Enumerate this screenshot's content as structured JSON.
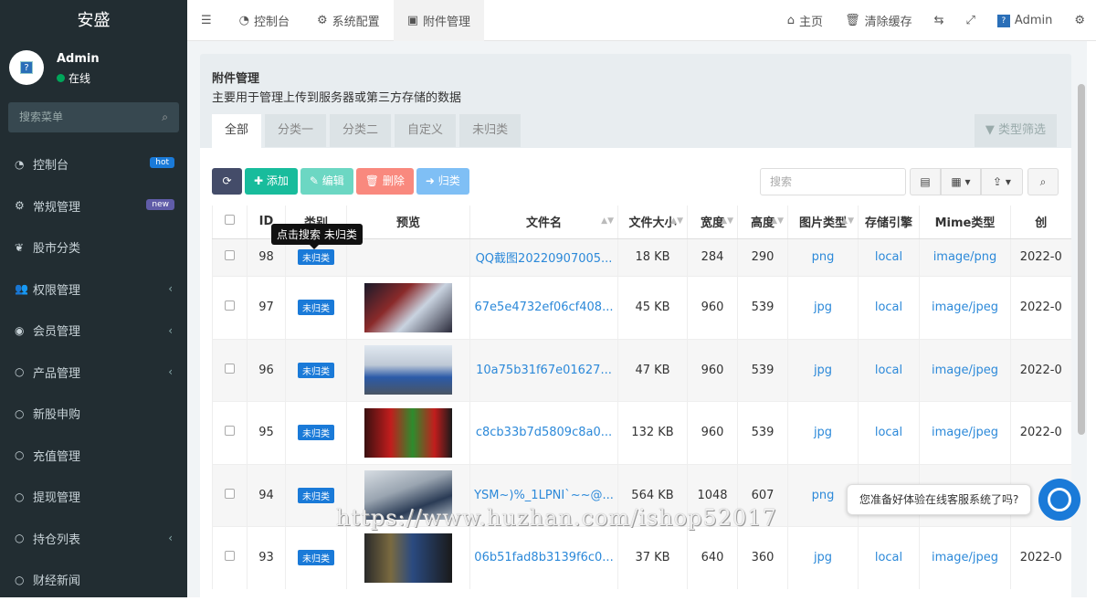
{
  "brand": "安盛",
  "user": {
    "name": "Admin",
    "status": "在线"
  },
  "sidebar": {
    "search_placeholder": "搜索菜单",
    "items": [
      {
        "label": "控制台",
        "badge": "hot",
        "icon": "dashboard-icon"
      },
      {
        "label": "常规管理",
        "badge": "new",
        "icon": "cogs-icon"
      },
      {
        "label": "股市分类",
        "icon": "leaf-icon"
      },
      {
        "label": "权限管理",
        "icon": "group-icon",
        "expandable": true
      },
      {
        "label": "会员管理",
        "icon": "user-circle-icon",
        "expandable": true
      },
      {
        "label": "产品管理",
        "icon": "circle-icon",
        "expandable": true
      },
      {
        "label": "新股申购",
        "icon": "circle-icon"
      },
      {
        "label": "充值管理",
        "icon": "circle-icon"
      },
      {
        "label": "提现管理",
        "icon": "circle-icon"
      },
      {
        "label": "持仓列表",
        "icon": "circle-icon",
        "expandable": true
      },
      {
        "label": "财经新闻",
        "icon": "circle-icon"
      }
    ]
  },
  "topnav": {
    "tabs": [
      {
        "label": "控制台",
        "icon": "dashboard-icon"
      },
      {
        "label": "系统配置",
        "icon": "gear-icon"
      },
      {
        "label": "附件管理",
        "icon": "file-image-icon",
        "active": true
      }
    ],
    "right": {
      "home": "主页",
      "clear_cache": "清除缓存",
      "user": "Admin"
    }
  },
  "panel": {
    "title": "附件管理",
    "description": "主要用于管理上传到服务器或第三方存储的数据",
    "tabs": [
      "全部",
      "分类一",
      "分类二",
      "自定义",
      "未归类"
    ],
    "filter_label": "类型筛选"
  },
  "toolbar": {
    "add": "添加",
    "edit": "编辑",
    "delete": "删除",
    "classify": "归类",
    "search_placeholder": "搜索"
  },
  "table": {
    "headers": [
      "ID",
      "类别",
      "预览",
      "文件名",
      "文件大小",
      "宽度",
      "高度",
      "图片类型",
      "存储引擎",
      "Mime类型",
      "创"
    ],
    "rows": [
      {
        "id": "98",
        "cat": "未归类",
        "file": "QQ截图20220907005...",
        "size": "18 KB",
        "w": "284",
        "h": "290",
        "type": "png",
        "engine": "local",
        "mime": "image/png",
        "date": "2022-0"
      },
      {
        "id": "97",
        "cat": "未归类",
        "file": "67e5e4732ef06cf408...",
        "size": "45 KB",
        "w": "960",
        "h": "539",
        "type": "jpg",
        "engine": "local",
        "mime": "image/jpeg",
        "date": "2022-0"
      },
      {
        "id": "96",
        "cat": "未归类",
        "file": "10a75b31f67e01627...",
        "size": "47 KB",
        "w": "960",
        "h": "539",
        "type": "jpg",
        "engine": "local",
        "mime": "image/jpeg",
        "date": "2022-0"
      },
      {
        "id": "95",
        "cat": "未归类",
        "file": "c8cb33b7d5809c8a0...",
        "size": "132 KB",
        "w": "960",
        "h": "539",
        "type": "jpg",
        "engine": "local",
        "mime": "image/jpeg",
        "date": "2022-0"
      },
      {
        "id": "94",
        "cat": "未归类",
        "file": "YSM~)%_1LPNI`~~@...",
        "size": "564 KB",
        "w": "1048",
        "h": "607",
        "type": "png",
        "engine": "",
        "mime": "",
        "date": ""
      },
      {
        "id": "93",
        "cat": "未归类",
        "file": "06b51fad8b3139f6c0...",
        "size": "37 KB",
        "w": "640",
        "h": "360",
        "type": "jpg",
        "engine": "local",
        "mime": "image/jpeg",
        "date": "2022-0"
      }
    ]
  },
  "tooltip": "点击搜索 未归类",
  "chat": {
    "prompt": "您准备好体验在线客服系统了吗?"
  },
  "watermark": "https://www.huzhan.com/ishop52017",
  "colors": {
    "sidebar": "#222d32",
    "primary": "#1a7ad8",
    "success": "#18bc9c",
    "danger": "#f75444",
    "info": "#4ea9f5",
    "dark": "#444c69"
  }
}
